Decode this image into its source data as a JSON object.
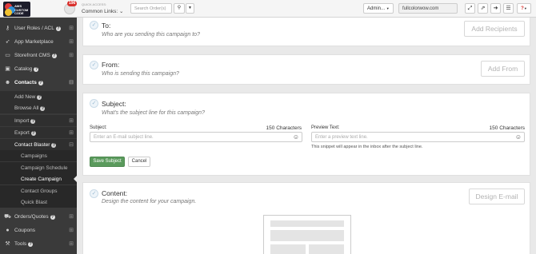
{
  "topbar": {
    "logo_text": [
      "AWS",
      "CUSTOM",
      "CODE"
    ],
    "notification_count": "196",
    "quick_access_label": "QUICK ACCESS:",
    "quick_links_label": "Common Links:",
    "search_placeholder": "Search Order(s)",
    "admin_label": "Admin...",
    "site_value": "fullcolorwow.com",
    "help_label": "?"
  },
  "sidebar": {
    "items": [
      {
        "label": "User Roles / ACL",
        "icon": "key-icon"
      },
      {
        "label": "App Marketplace",
        "icon": "rocket-icon"
      },
      {
        "label": "Storefront CMS",
        "icon": "monitor-icon"
      },
      {
        "label": "Catalog",
        "icon": "cubes-icon"
      },
      {
        "label": "Contacts",
        "icon": "users-icon"
      },
      {
        "label": "Orders/Quotes",
        "icon": "cart-icon"
      },
      {
        "label": "Coupons",
        "icon": "coin-icon"
      },
      {
        "label": "Tools",
        "icon": "wrench-icon"
      }
    ],
    "contacts_sub": [
      {
        "label": "Add New"
      },
      {
        "label": "Browse All"
      },
      {
        "label": "Import"
      },
      {
        "label": "Export"
      },
      {
        "label": "Contact Blaster"
      }
    ],
    "blaster_sub": [
      {
        "label": "Campaigns"
      },
      {
        "label": "Campaign Schedule"
      },
      {
        "label": "Create Campaign"
      },
      {
        "label": "Contact Groups"
      },
      {
        "label": "Quick Blast"
      }
    ]
  },
  "to": {
    "title": "To:",
    "subtitle": "Who are you sending this campaign to?",
    "button": "Add Recipients"
  },
  "from": {
    "title": "From:",
    "subtitle": "Who is sending this campaign?",
    "button": "Add From"
  },
  "subject": {
    "title": "Subject:",
    "subtitle": "What's the subject line for this campaign?",
    "subject_label": "Subject:",
    "subject_count": "150 Characters",
    "subject_placeholder": "Enter an E-mail subject line.",
    "preview_label": "Preview Text:",
    "preview_count": "150 Characters",
    "preview_placeholder": "Enter a preview text line.",
    "preview_hint": "This snippet will appear in the inbox after the subject line.",
    "save_label": "Save Subject",
    "cancel_label": "Cancel"
  },
  "content": {
    "title": "Content:",
    "subtitle": "Design the content for your campaign.",
    "button": "Design E-mail"
  },
  "colors": {
    "sidebar_bg": "#3a3a3a",
    "save_green": "#5a9a5c",
    "badge_red": "#d9302c"
  }
}
